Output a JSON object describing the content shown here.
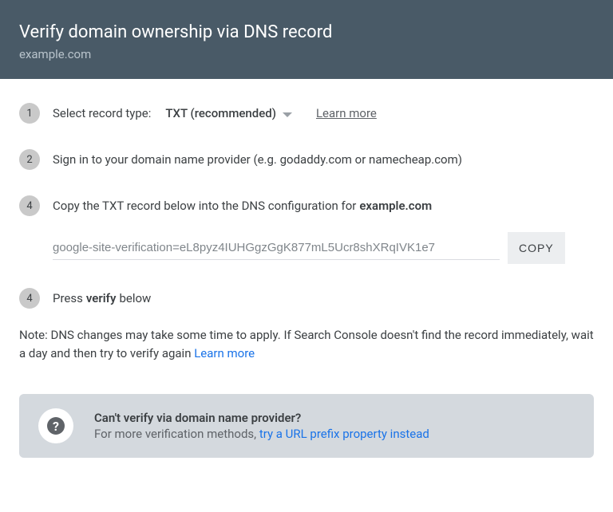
{
  "header": {
    "title": "Verify domain ownership via DNS record",
    "domain": "example.com"
  },
  "steps": {
    "s1": {
      "num": "1",
      "label": "Select record type:",
      "dropdown_value": "TXT (recommended)",
      "learn_more": "Learn more"
    },
    "s2": {
      "num": "2",
      "text": "Sign in to your domain name provider (e.g. godaddy.com or namecheap.com)"
    },
    "s3": {
      "num": "4",
      "prefix": "Copy the TXT record below into the DNS configuration for ",
      "domain": "example.com",
      "code": "google-site-verification=eL8pyz4IUHGgzGgK877mL5Ucr8shXRqIVK1e7",
      "copy_label": "COPY"
    },
    "s4": {
      "num": "4",
      "prefix": "Press ",
      "bold": "verify",
      "suffix": " below"
    }
  },
  "note": {
    "text": "Note: DNS changes may take some time to apply. If Search Console doesn't find the record immediately, wait a day and then try to verify again ",
    "link": "Learn more"
  },
  "help": {
    "title": "Can't verify via domain name provider?",
    "sub_prefix": "For more verification methods, ",
    "link": "try a URL prefix property instead"
  }
}
